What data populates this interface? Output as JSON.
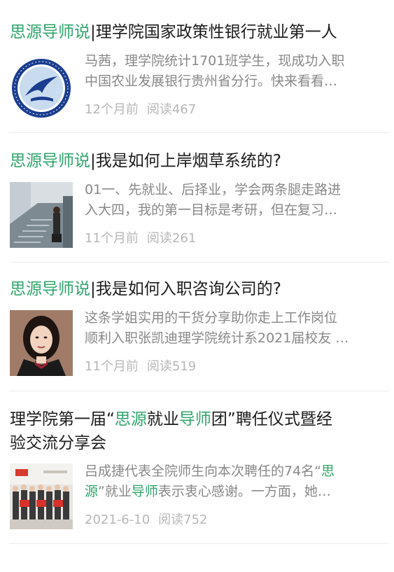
{
  "articles": [
    {
      "title_prefix": "思源导师说",
      "title_sep": "|",
      "title_rest": "理学院国家政策性银行就业第一人",
      "summary_line1": "马茜，理学院统计1701班学生，现成功入职",
      "summary_line2": "中国农业发展银行贵州省分行。快来看看…",
      "time": "12个月前",
      "reads": "阅读467",
      "thumb_icon": "university-logo-icon"
    },
    {
      "title_prefix": "思源导师说",
      "title_sep": "|",
      "title_rest": "我是如何上岸烟草系统的?",
      "summary_line1": "01一、先就业、后择业，学会两条腿走路进",
      "summary_line2": "入大四，我的第一目标是考研，但在复习…",
      "time": "11个月前",
      "reads": "阅读261",
      "thumb_icon": "photo-staircase"
    },
    {
      "title_prefix": "思源导师说",
      "title_sep": "|",
      "title_rest": "我是如何入职咨询公司的?",
      "summary_line1": "这条学姐实用的干货分享助你走上工作岗位",
      "summary_line2": "顺利入职张凯迪理学院统计系2021届校友 …",
      "time": "11个月前",
      "reads": "阅读519",
      "thumb_icon": "photo-portrait"
    },
    {
      "title_part1": "理学院第一届“",
      "title_hl1": "思源",
      "title_part2": "就业",
      "title_hl2": "导师",
      "title_part3": "团”聘任仪式暨经",
      "title_line2": "验交流分享会",
      "summary_a": "吕成捷代表全院师生向本次聘任的74名“",
      "summary_hl1": "思",
      "summary_hl2": "源",
      "summary_b": "”就业",
      "summary_hl3": "导师",
      "summary_c": "表示衷心感谢。一方面，她…",
      "time": "2021-6-10",
      "reads": "阅读752",
      "thumb_icon": "photo-ceremony"
    }
  ],
  "colors": {
    "accent_green": "#2fa56b",
    "meta_gray": "#b7b7b7",
    "summary_gray": "#888888"
  }
}
